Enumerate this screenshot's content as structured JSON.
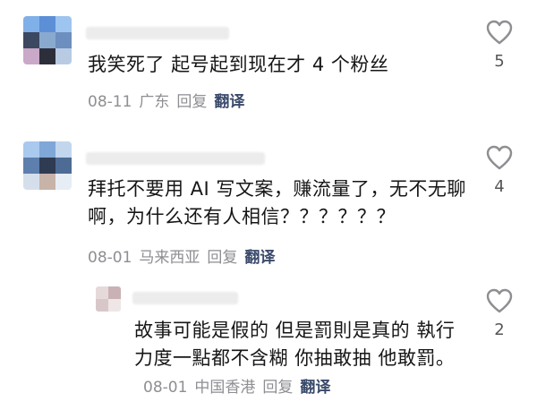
{
  "comments": [
    {
      "text": "我笑死了 起号起到现在才 4 个粉丝",
      "date": "08-11",
      "location": "广东",
      "reply": "回复",
      "translate": "翻译",
      "likes": "5"
    },
    {
      "text": "拜托不要用 AI 写文案，赚流量了，无不无聊啊，为什么还有人相信？？？？？？",
      "date": "08-01",
      "location": "马来西亚",
      "reply": "回复",
      "translate": "翻译",
      "likes": "4"
    },
    {
      "text": "故事可能是假的 但是罰則是真的 執行力度一點都不含糊 你抽敢抽 他敢罰。",
      "date": "08-01",
      "location": "中国香港",
      "reply": "回复",
      "translate": "翻译",
      "likes": "2"
    }
  ],
  "colors": {
    "meta": "#8e8e93",
    "translate": "#3a4a6b",
    "heart_outline": "#8e8e93"
  },
  "icons": {
    "like": "heart-outline-icon"
  }
}
